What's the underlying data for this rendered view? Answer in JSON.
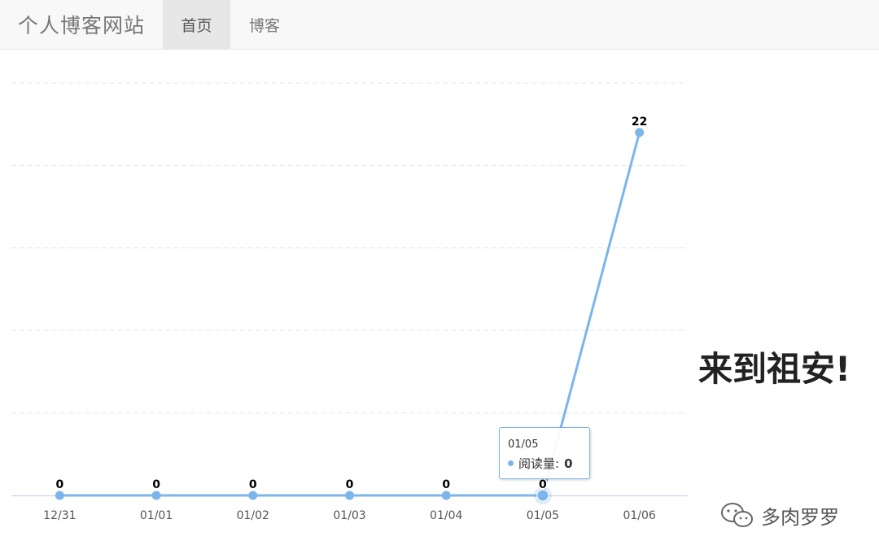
{
  "navbar": {
    "brand": "个人博客网站",
    "items": [
      {
        "label": "首页",
        "active": true
      },
      {
        "label": "博客",
        "active": false
      }
    ]
  },
  "chart_data": {
    "type": "line",
    "categories": [
      "12/31",
      "01/01",
      "01/02",
      "01/03",
      "01/04",
      "01/05",
      "01/06"
    ],
    "series": [
      {
        "name": "阅读量",
        "values": [
          0,
          0,
          0,
          0,
          0,
          0,
          22
        ],
        "color": "#7cb5ec"
      }
    ],
    "ylim": [
      0,
      25
    ],
    "yticks": [
      0,
      5,
      10,
      15,
      20,
      25
    ],
    "y_tick_labels_shown": false,
    "grid": true,
    "data_labels": true
  },
  "tooltip": {
    "category": "01/05",
    "series_name": "阅读量",
    "series_label_suffix": ":",
    "value": "0",
    "color": "#7cb5ec"
  },
  "slogan": "来到祖安!",
  "watermark": {
    "text": "多肉罗罗",
    "icon": "wechat-icon"
  }
}
